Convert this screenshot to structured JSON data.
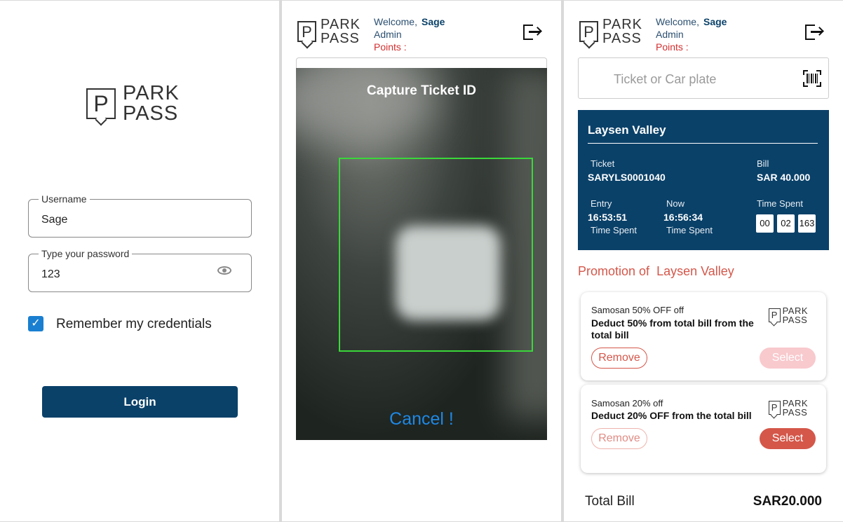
{
  "brand": {
    "line1": "PARK",
    "line2": "PASS",
    "mark": "P"
  },
  "login": {
    "username_label": "Username",
    "username_value": "Sage",
    "password_label": "Type your password",
    "password_value": "123",
    "remember_label": "Remember my credentials",
    "remember_checked": true,
    "login_button": "Login"
  },
  "header": {
    "welcome": "Welcome,",
    "user": "Sage",
    "role": "Admin",
    "points": "Points :"
  },
  "scanner": {
    "title": "Capture Ticket ID",
    "cancel": "Cancel !"
  },
  "dashboard": {
    "search_placeholder": "Ticket or Car plate",
    "location": "Laysen Valley",
    "ticket_label": "Ticket",
    "ticket_value": "SARYLS0001040",
    "bill_label": "Bill",
    "bill_value": "SAR 40.000",
    "entry_label": "Entry",
    "entry_value": "16:53:51",
    "entry_sub": "Time Spent",
    "now_label": "Now",
    "now_value": "16:56:34",
    "now_sub": "Time Spent",
    "time_spent_label": "Time Spent",
    "time_spent_boxes": [
      "00",
      "02",
      "163"
    ],
    "promotion_prefix": "Promotion of",
    "promotion_location": "Laysen Valley",
    "promotions": [
      {
        "name": "Samosan 50% OFF off",
        "description": "Deduct 50% from total bill from the total bill",
        "remove": "Remove",
        "select": "Select",
        "select_enabled": false
      },
      {
        "name": "Samosan 20% off",
        "description": "Deduct 20% OFF from the total bill",
        "remove": "Remove",
        "select": "Select",
        "select_enabled": true
      }
    ],
    "total_label": "Total Bill",
    "total_value": "SAR20.000"
  },
  "colors": {
    "primary": "#0a4169",
    "accent": "#d4574a",
    "points": "#d32f2f",
    "scan_frame": "#3ad83a",
    "cancel": "#1e88e5",
    "checkbox": "#1a7fd0"
  },
  "icons": [
    "logout-icon",
    "eye-icon",
    "barcode-scan-icon",
    "check-icon"
  ]
}
